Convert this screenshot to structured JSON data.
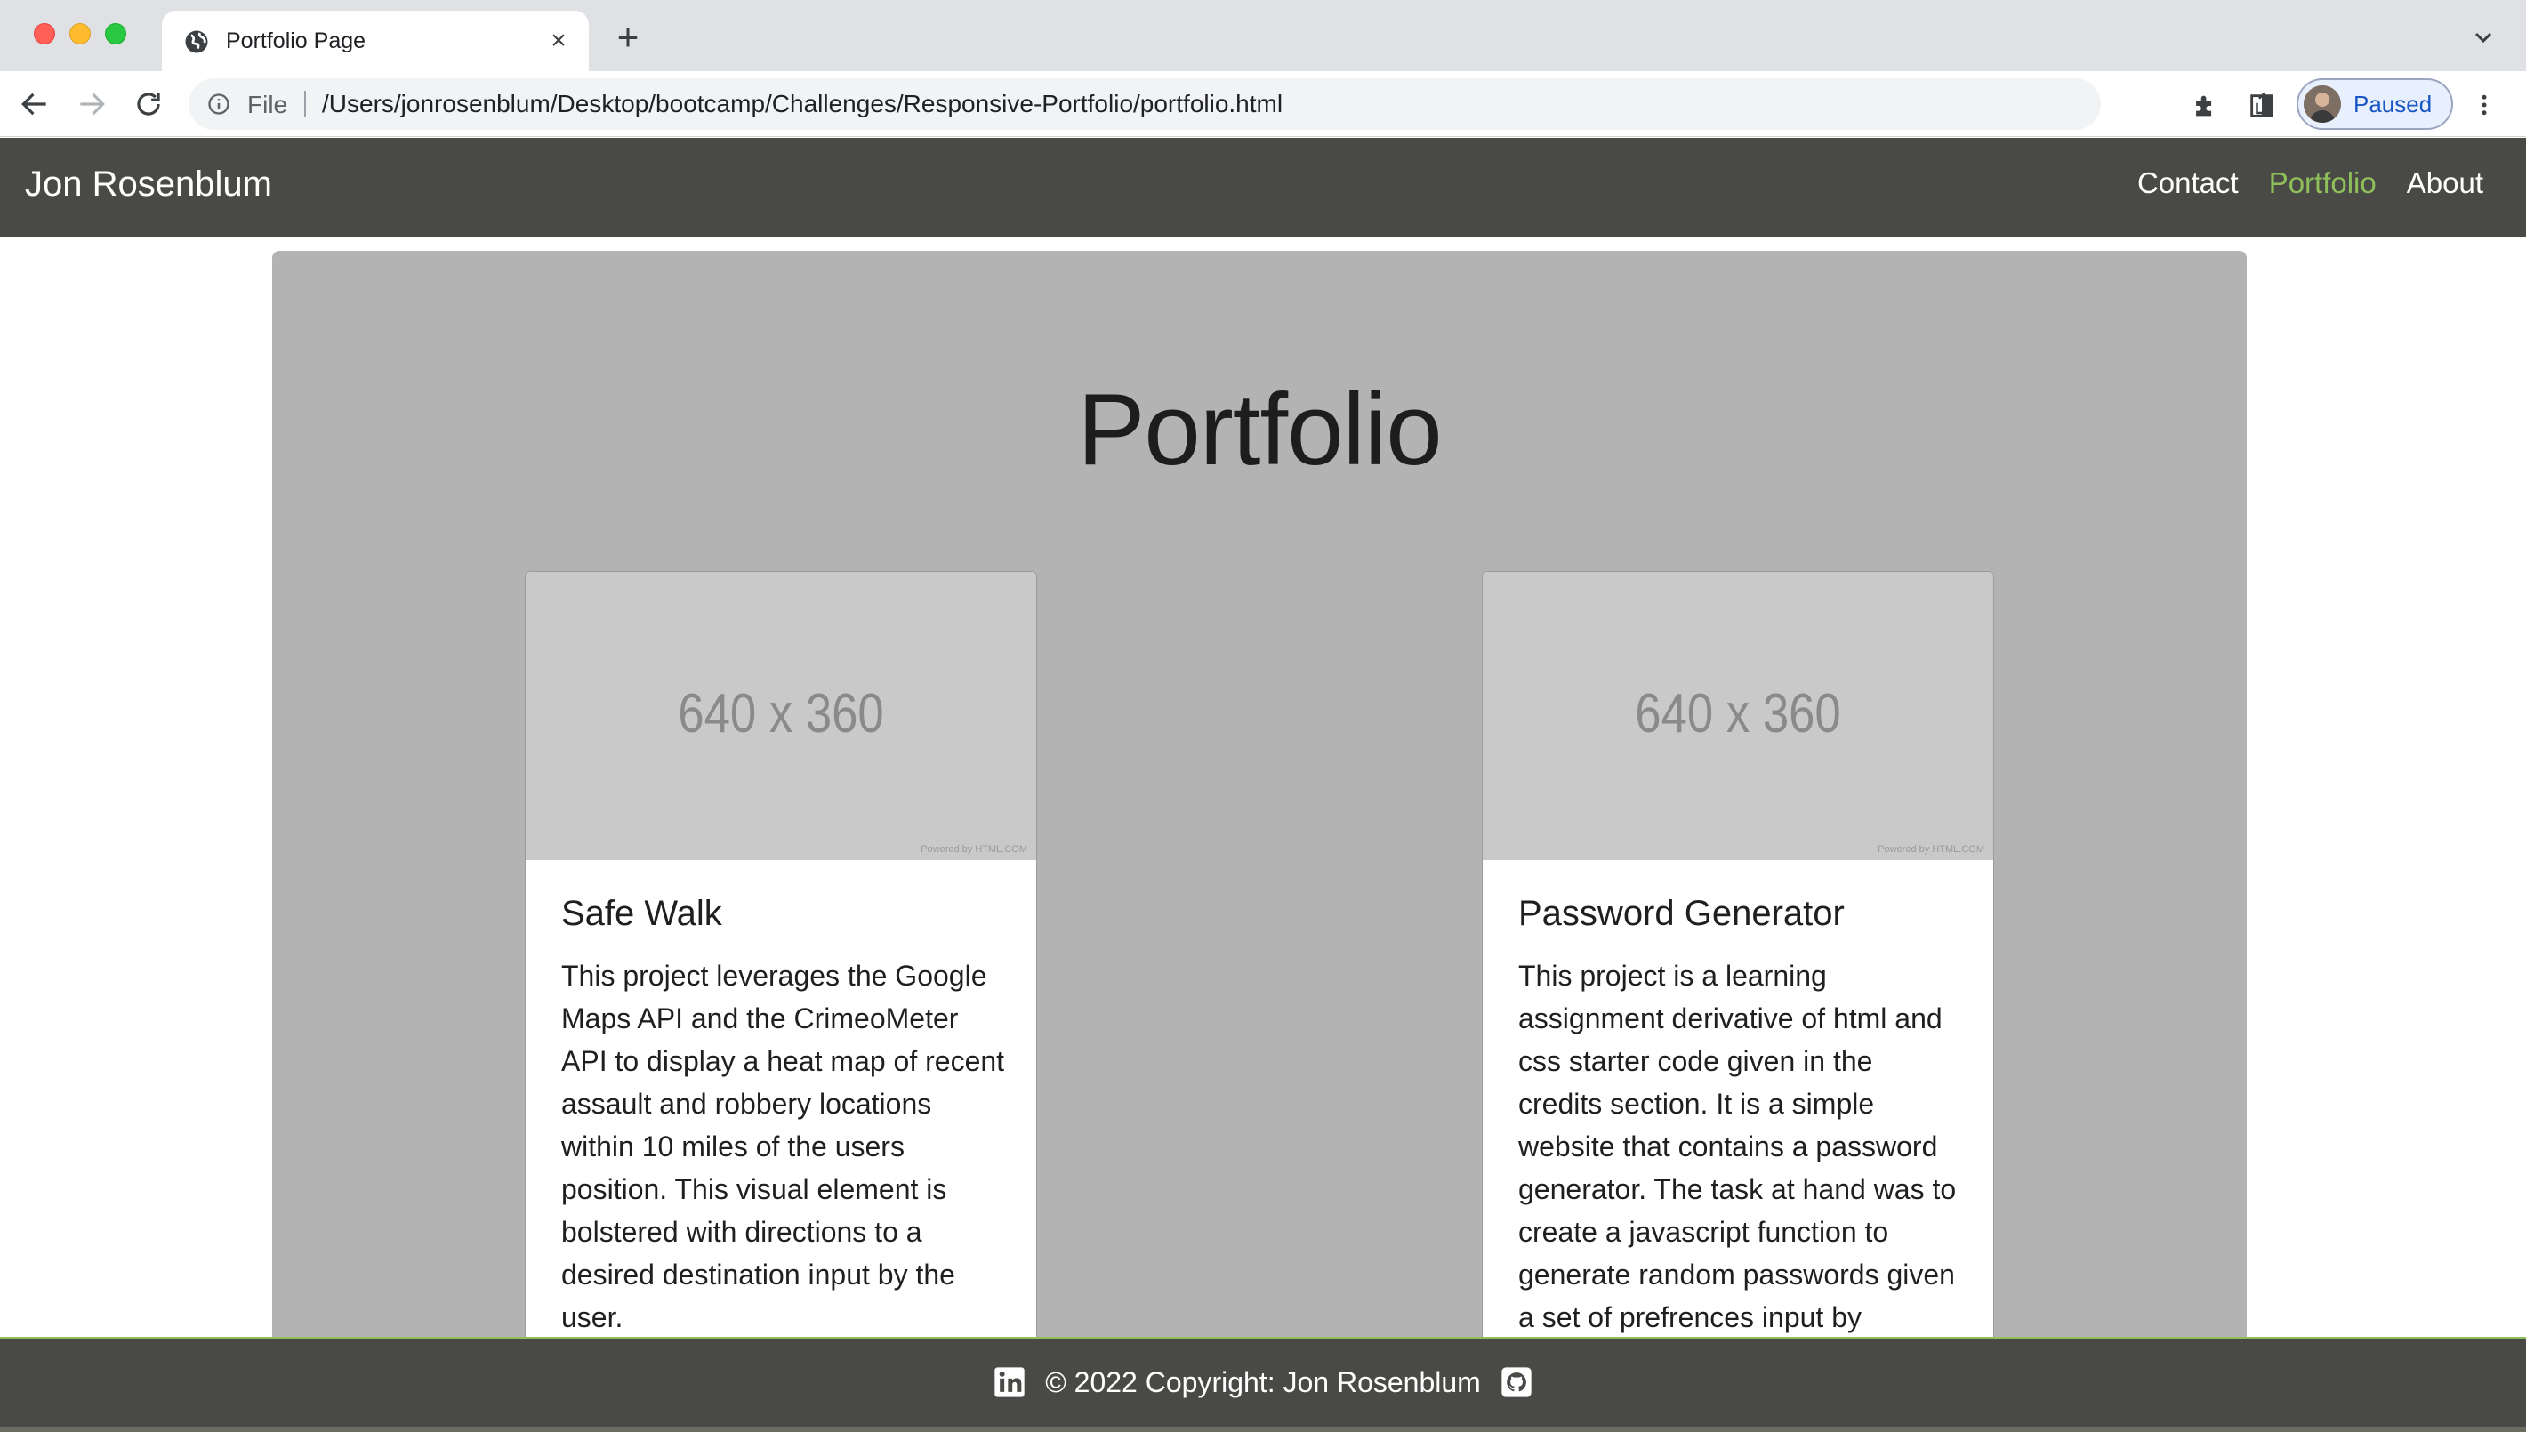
{
  "browser": {
    "tab_title": "Portfolio Page",
    "scheme_label": "File",
    "url": "/Users/jonrosenblum/Desktop/bootcamp/Challenges/Responsive-Portfolio/portfolio.html",
    "profile_label": "Paused"
  },
  "site": {
    "brand": "Jon Rosenblum",
    "nav": [
      {
        "label": "Contact",
        "active": false
      },
      {
        "label": "Portfolio",
        "active": true
      },
      {
        "label": "About",
        "active": false
      }
    ],
    "heading": "Portfolio",
    "cards": [
      {
        "image_text": "640 x 360",
        "image_credit": "Powered by HTML.COM",
        "title": "Safe Walk",
        "text": "This project leverages the Google Maps API and the CrimeoMeter API to display a heat map of recent assault and robbery locations within 10 miles of the users position. This visual element is bolstered with directions to a desired destination input by the user."
      },
      {
        "image_text": "640 x 360",
        "image_credit": "Powered by HTML.COM",
        "title": "Password Generator",
        "text": "This project is a learning assignment derivative of html and css starter code given in the credits section. It is a simple website that contains a password generator. The task at hand was to create a javascript function to generate random passwords given a set of prefrences input by"
      }
    ],
    "footer_text": "© 2022 Copyright: Jon Rosenblum"
  },
  "colors": {
    "nav_bg": "#494946",
    "accent": "#8fbf5a",
    "jumbotron_bg": "#b3b3b3"
  }
}
